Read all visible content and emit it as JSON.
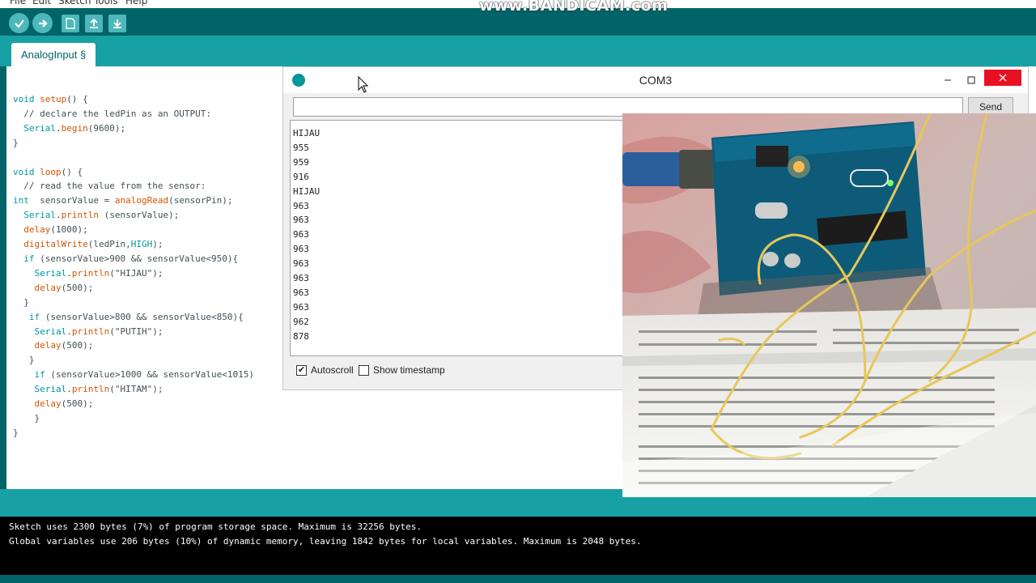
{
  "menu": [
    "File",
    "Edit",
    "Sketch",
    "Tools",
    "Help"
  ],
  "watermark": "www.BANDICAM.com",
  "toolbar": {
    "verify_icon": "check-icon",
    "upload_icon": "arrow-right-icon",
    "new_icon": "new-file-icon",
    "open_icon": "open-icon",
    "save_icon": "save-icon"
  },
  "tab": {
    "label": "AnalogInput §"
  },
  "serial_monitor": {
    "title": "COM3",
    "send_label": "Send",
    "input_value": "",
    "output_lines": [
      "HIJAU",
      "955",
      "959",
      "916",
      "HIJAU",
      "963",
      "963",
      "963",
      "963",
      "963",
      "963",
      "963",
      "963",
      "962",
      "878"
    ],
    "autoscroll_label": "Autoscroll",
    "autoscroll_checked": true,
    "timestamp_label": "Show timestamp",
    "timestamp_checked": false
  },
  "console": {
    "lines": [
      "Sketch uses 2300 bytes (7%) of program storage space. Maximum is 32256 bytes.",
      "Global variables use 206 bytes (10%) of dynamic memory, leaving 1842 bytes for local variables. Maximum is 2048 bytes."
    ]
  },
  "colors": {
    "teal_dark": "#006468",
    "teal_light": "#17a1a5",
    "keyword": "#00979c",
    "function": "#d35400",
    "close_red": "#e81123"
  }
}
